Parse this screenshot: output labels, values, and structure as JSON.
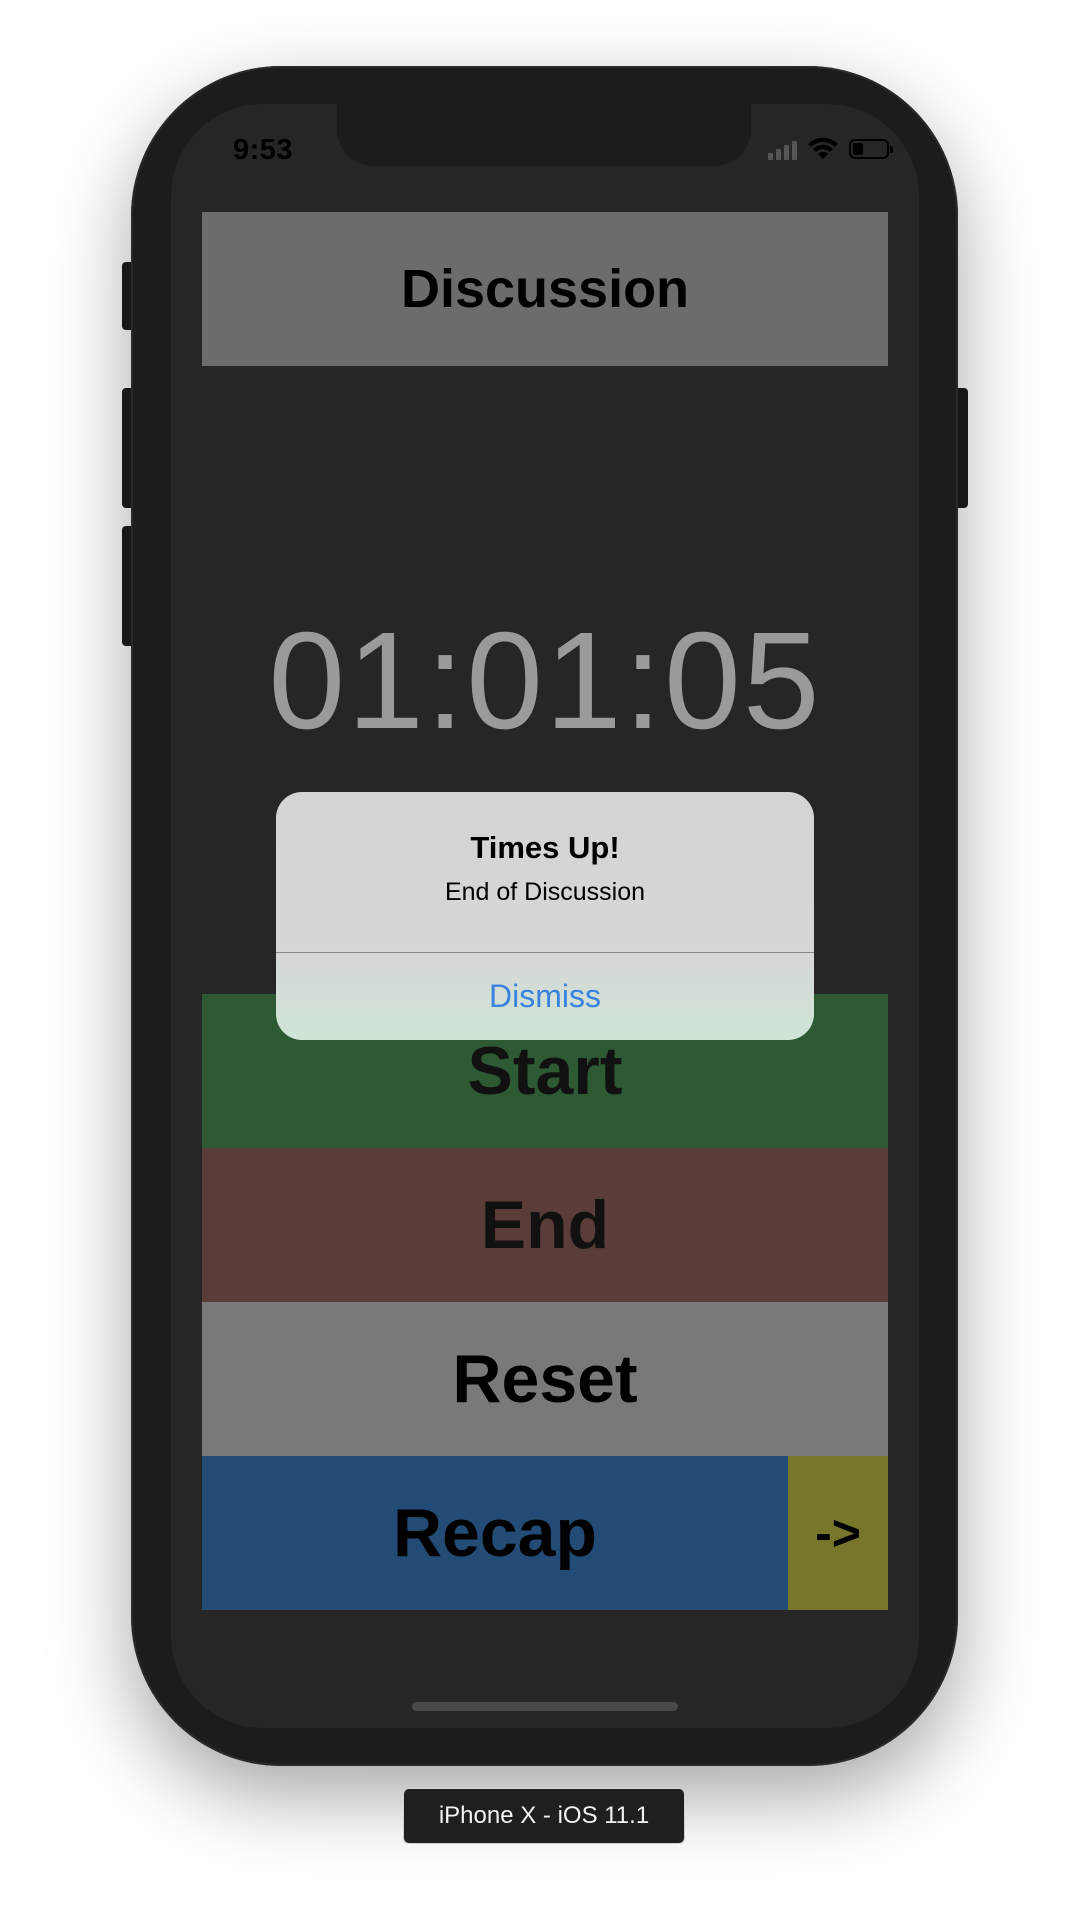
{
  "status_bar": {
    "time": "9:53",
    "battery_level": 0.3
  },
  "screen": {
    "title": "Discussion",
    "timer": "01:01:05",
    "buttons": {
      "start": "Start",
      "end": "End",
      "reset": "Reset",
      "recap": "Recap",
      "next": "->"
    },
    "colors": {
      "title_bg": "#6c6c6c",
      "start": "#2d5a33",
      "end": "#5a3d38",
      "reset": "#797979",
      "recap": "#224c75",
      "next": "#77762a"
    }
  },
  "alert": {
    "title": "Times Up!",
    "message": "End of Discussion",
    "action": "Dismiss",
    "action_color": "#3a82e0"
  },
  "simulator": {
    "device_label": "iPhone X - iOS 11.1"
  },
  "icons": [
    "cellular-signal-icon",
    "wifi-icon",
    "battery-icon"
  ]
}
